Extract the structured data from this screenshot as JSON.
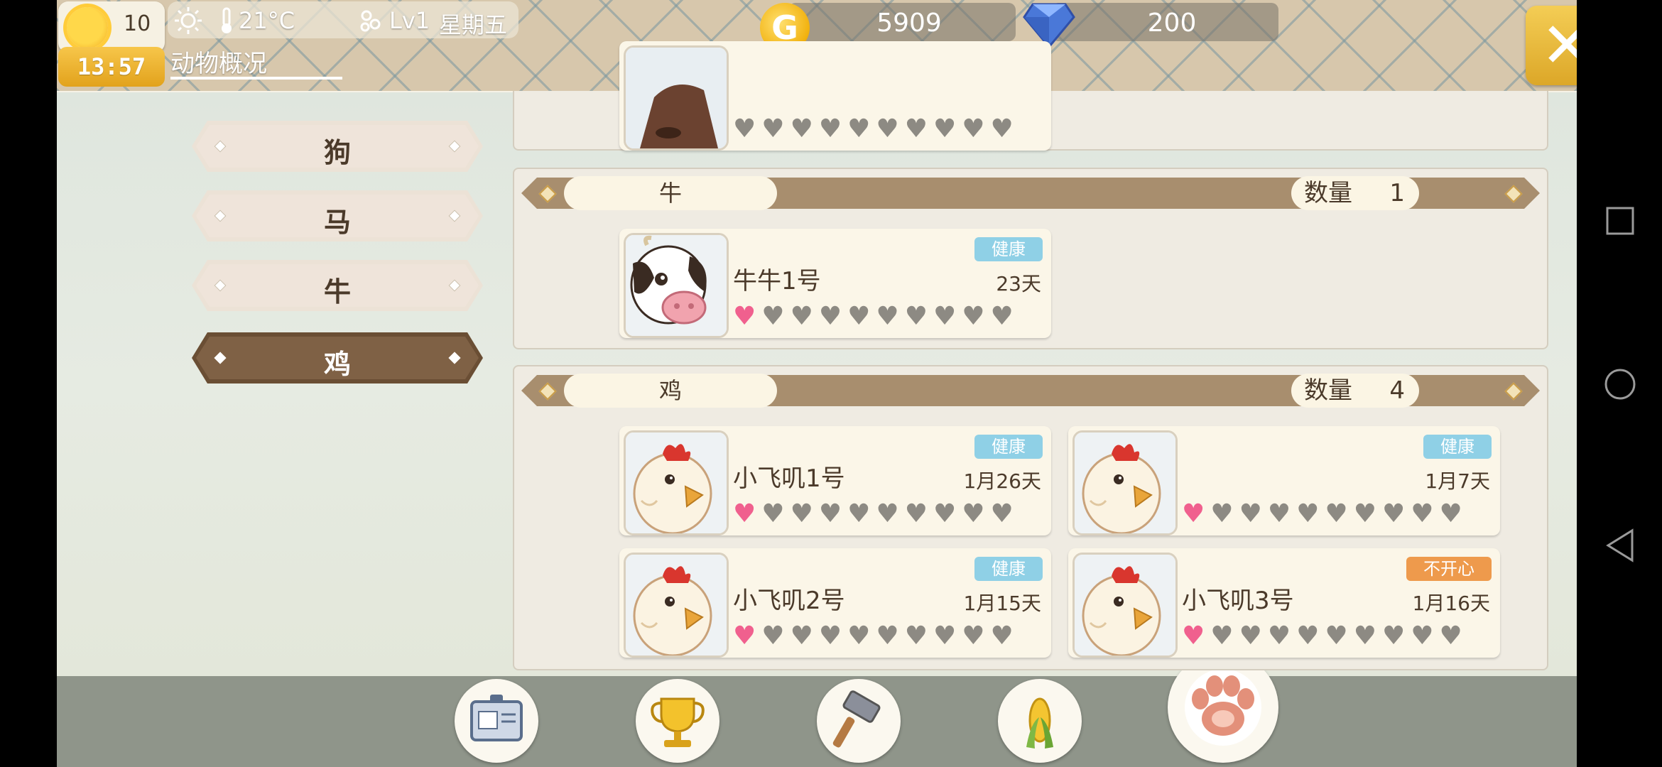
{
  "status_bar": {
    "day": "10",
    "clock": "13:57",
    "temperature": "21°C",
    "level": "Lv1",
    "weekday": "星期五"
  },
  "page_tab": "动物概况",
  "currency": {
    "gold": "5909",
    "gems": "200",
    "gold_symbol": "G"
  },
  "close_label": "✕",
  "categories": [
    {
      "label": "狗",
      "active": false
    },
    {
      "label": "马",
      "active": false
    },
    {
      "label": "牛",
      "active": false
    },
    {
      "label": "鸡",
      "active": true
    }
  ],
  "count_label": "数量",
  "groups": [
    {
      "name": "牛",
      "count": "1",
      "animals": [
        {
          "name": "牛牛1号",
          "age": "23天",
          "status": "健康",
          "status_type": "ok",
          "hearts": 1,
          "avatar": "cow"
        }
      ]
    },
    {
      "name": "鸡",
      "count": "4",
      "animals": [
        {
          "name": "小飞叽1号",
          "age": "1月26天",
          "status": "健康",
          "status_type": "ok",
          "hearts": 1,
          "avatar": "chicken"
        },
        {
          "name": "",
          "age": "1月7天",
          "status": "健康",
          "status_type": "ok",
          "hearts": 1,
          "avatar": "chicken"
        },
        {
          "name": "小飞叽2号",
          "age": "1月15天",
          "status": "健康",
          "status_type": "ok",
          "hearts": 1,
          "avatar": "chicken"
        },
        {
          "name": "小飞叽3号",
          "age": "1月16天",
          "status": "不开心",
          "status_type": "bad",
          "hearts": 1,
          "avatar": "chicken"
        }
      ]
    }
  ],
  "max_hearts": 10,
  "bottom_nav": [
    "id-card-icon",
    "trophy-icon",
    "hammer-icon",
    "corn-icon",
    "paw-icon"
  ],
  "colors": {
    "heart_on": "#f0608e",
    "heart_off": "#8d8a83",
    "status_ok": "#8fd0e6",
    "status_bad": "#ee9a4c",
    "active_tab": "#7f6145"
  }
}
